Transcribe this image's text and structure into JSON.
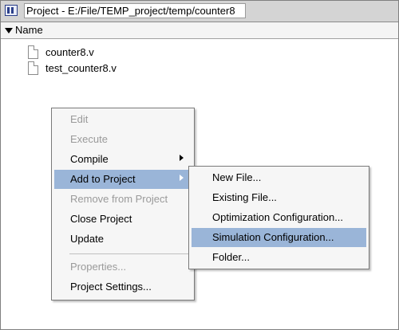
{
  "window": {
    "title": "Project - E:/File/TEMP_project/temp/counter8"
  },
  "header": {
    "column_label": "Name"
  },
  "files": [
    {
      "name": "counter8.v"
    },
    {
      "name": "test_counter8.v"
    }
  ],
  "context_menu": {
    "items": [
      {
        "label": "Edit",
        "enabled": false
      },
      {
        "label": "Execute",
        "enabled": false
      },
      {
        "label": "Compile",
        "enabled": true,
        "submenu": true
      },
      {
        "label": "Add to Project",
        "enabled": true,
        "submenu": true,
        "highlighted": true
      },
      {
        "label": "Remove from Project",
        "enabled": false
      },
      {
        "label": "Close Project",
        "enabled": true
      },
      {
        "label": "Update",
        "enabled": true
      },
      {
        "label": "Properties...",
        "enabled": false
      },
      {
        "label": "Project Settings...",
        "enabled": true
      }
    ]
  },
  "submenu": {
    "items": [
      {
        "label": "New File..."
      },
      {
        "label": "Existing File..."
      },
      {
        "label": "Optimization Configuration..."
      },
      {
        "label": "Simulation Configuration...",
        "highlighted": true
      },
      {
        "label": "Folder..."
      }
    ]
  },
  "colors": {
    "highlight": "#9ab5d8",
    "disabled_text": "#9a9a9a",
    "menu_background": "#f6f6f6"
  }
}
